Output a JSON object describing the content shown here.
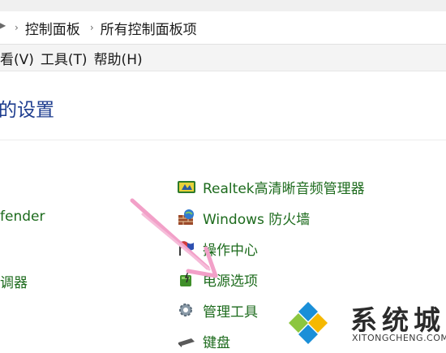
{
  "breadcrumb": {
    "items": [
      "控制面板",
      "所有控制面板项"
    ]
  },
  "menu": {
    "items": [
      "看(V)",
      "工具(T)",
      "帮助(H)"
    ]
  },
  "page": {
    "title": "的设置"
  },
  "left_column": {
    "items": [
      "fender",
      "调器"
    ]
  },
  "right_column": {
    "items": [
      {
        "label": "Realtek高清晰音频管理器",
        "icon": "realtek-audio-icon"
      },
      {
        "label": "Windows 防火墙",
        "icon": "firewall-icon"
      },
      {
        "label": "操作中心",
        "icon": "action-center-flag-icon"
      },
      {
        "label": "电源选项",
        "icon": "power-options-icon"
      },
      {
        "label": "管理工具",
        "icon": "admin-tools-icon"
      },
      {
        "label": "键盘",
        "icon": "keyboard-icon"
      }
    ]
  },
  "watermark": {
    "brand": "系统城",
    "domain": "XITONGCHENG.COM"
  },
  "colors": {
    "link_green": "#1d6b1d",
    "title_blue": "#1e3d8f",
    "annotation_pink": "#f2a0c8",
    "logo_blue": "#1a8fd8"
  }
}
